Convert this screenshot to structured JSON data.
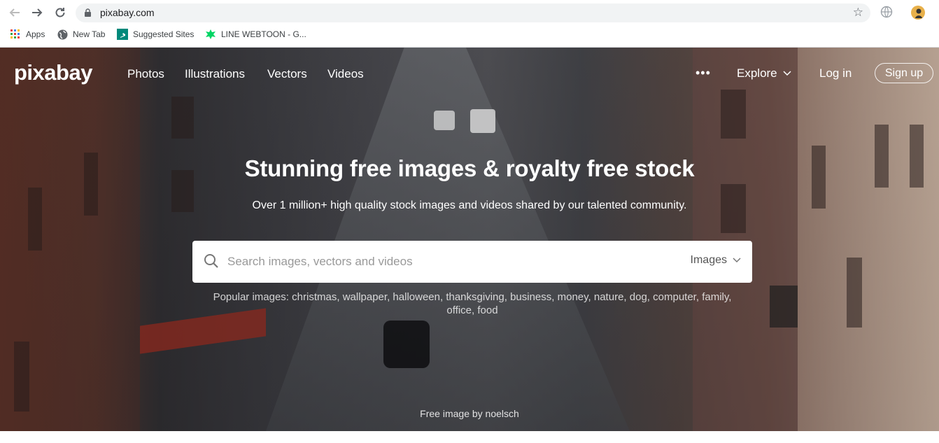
{
  "browser": {
    "url": "pixabay.com",
    "bookmarks": [
      {
        "label": "Apps",
        "icon": "apps-grid-icon"
      },
      {
        "label": "New Tab",
        "icon": "globe-icon"
      },
      {
        "label": "Suggested Sites",
        "icon": "bing-icon"
      },
      {
        "label": "LINE WEBTOON - G...",
        "icon": "webtoon-icon"
      }
    ]
  },
  "site": {
    "logo": "pixabay",
    "nav": [
      "Photos",
      "Illustrations",
      "Vectors",
      "Videos"
    ],
    "more": "•••",
    "explore": "Explore",
    "login": "Log in",
    "signup": "Sign up"
  },
  "hero": {
    "headline": "Stunning free images & royalty free stock",
    "subline": "Over 1 million+ high quality stock images and videos shared by our talented community.",
    "search_placeholder": "Search images, vectors and videos",
    "search_type": "Images",
    "popular_label": "Popular images:",
    "popular_tags": [
      "christmas",
      "wallpaper",
      "halloween",
      "thanksgiving",
      "business",
      "money",
      "nature",
      "dog",
      "computer",
      "family",
      "office",
      "food"
    ],
    "credit": "Free image by noelsch"
  },
  "colors": {
    "accent": "#ffffff",
    "chrome": "#f1f3f4"
  }
}
